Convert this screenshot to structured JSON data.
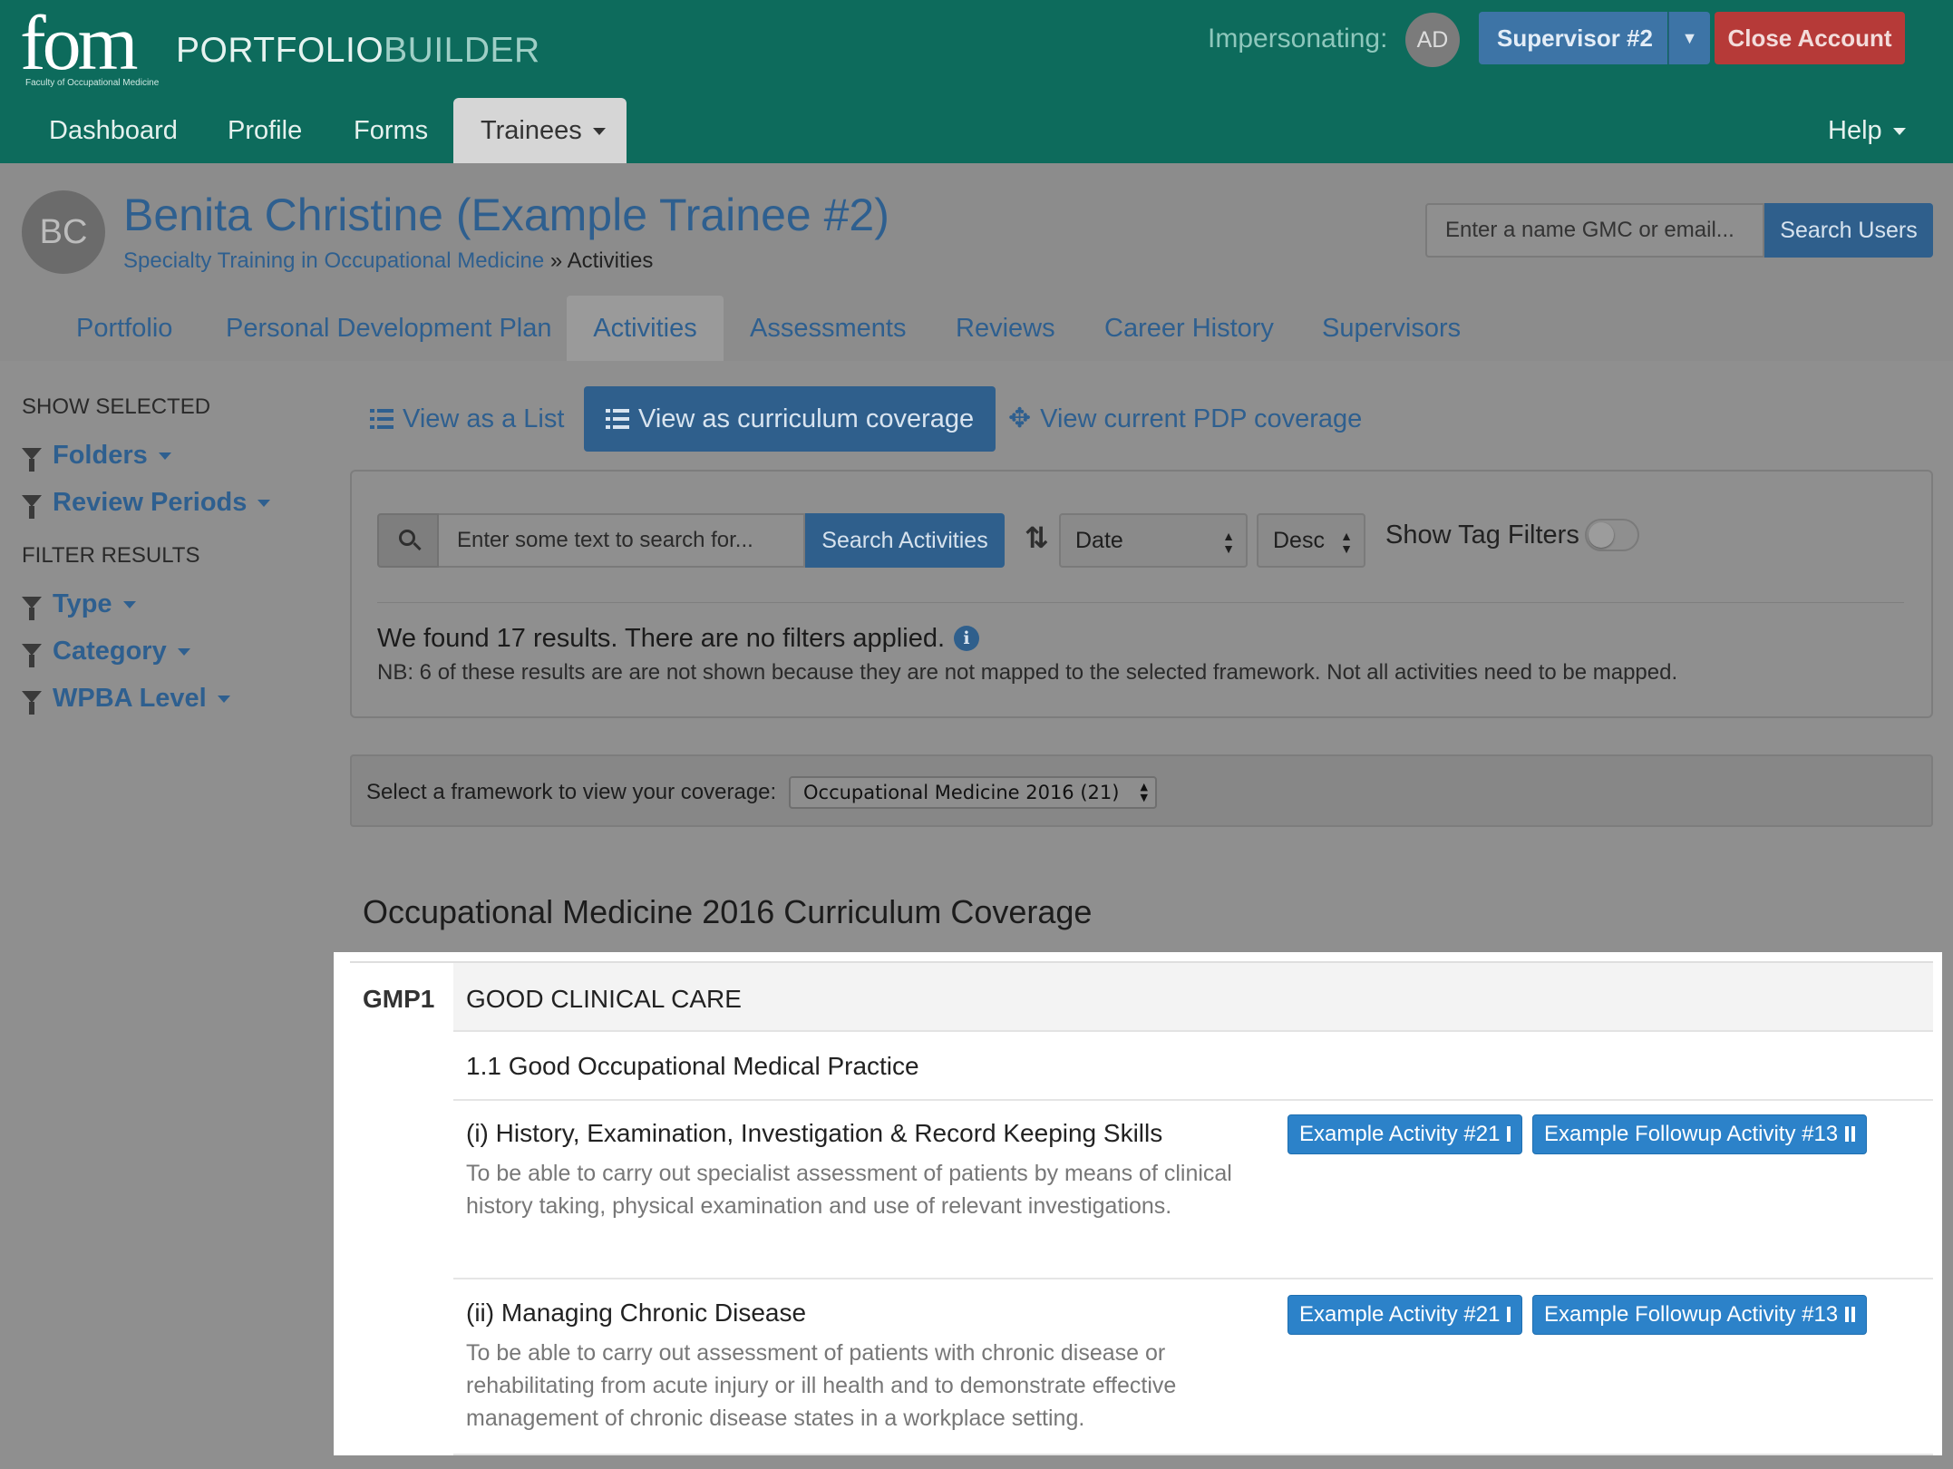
{
  "header": {
    "logo_text": "fom",
    "logo_subtitle": "Faculty of Occupational Medicine",
    "brand_part1": "PORTFOLIO",
    "brand_part2": "BUILDER",
    "impersonating_label": "Impersonating:",
    "impersonating_initials": "AD",
    "supervisor_label": "Supervisor #2",
    "close_account_label": "Close Account",
    "nav": [
      "Dashboard",
      "Profile",
      "Forms",
      "Trainees"
    ],
    "help_label": "Help"
  },
  "profile": {
    "initials": "BC",
    "name": "Benita Christine (Example Trainee #2)",
    "breadcrumb_link": "Specialty Training in Occupational Medicine",
    "breadcrumb_sep": "»",
    "breadcrumb_current": "Activities",
    "search_placeholder": "Enter a name GMC or email...",
    "search_button": "Search Users"
  },
  "tabs": [
    "Portfolio",
    "Personal Development Plan",
    "Activities",
    "Assessments",
    "Reviews",
    "Career History",
    "Supervisors"
  ],
  "active_tab": "Activities",
  "sidebar": {
    "show_selected_heading": "SHOW SELECTED",
    "show_selected": [
      "Folders",
      "Review Periods"
    ],
    "filter_results_heading": "FILTER RESULTS",
    "filter_results": [
      "Type",
      "Category",
      "WPBA Level"
    ]
  },
  "views": {
    "list": "View as a List",
    "curriculum": "View as curriculum coverage",
    "pdp": "View current PDP coverage"
  },
  "search": {
    "placeholder": "Enter some text to search for...",
    "button": "Search Activities",
    "sort_field": "Date",
    "sort_order": "Desc",
    "tag_filters_label": "Show Tag Filters",
    "tag_filters_on": false,
    "results_text": "We found 17 results. There are no filters applied.",
    "info_icon": "i",
    "nb_text": "NB: 6 of these results are are not shown because they are not mapped to the selected framework. Not all activities need to be mapped."
  },
  "framework": {
    "label": "Select a framework to view your coverage:",
    "selected": "Occupational Medicine 2016 (21)"
  },
  "coverage": {
    "title": "Occupational Medicine 2016 Curriculum Coverage",
    "gmp_code": "GMP1",
    "gmp_name": "GOOD CLINICAL CARE",
    "section": "1.1 Good Occupational Medical Practice",
    "items": [
      {
        "title": "(i) History, Examination, Investigation & Record Keeping Skills",
        "description": "To be able to carry out specialist assessment of patients by means of clinical history taking, physical examination and use of relevant investigations.",
        "activities": [
          "Example Activity #21",
          "Example Followup Activity #13"
        ]
      },
      {
        "title": "(ii) Managing Chronic Disease",
        "description": "To be able to carry out assessment of patients with chronic disease or rehabilitating from acute injury or ill health and to demonstrate effective management of chronic disease states in a workplace setting.",
        "activities": [
          "Example Activity #21",
          "Example Followup Activity #13"
        ]
      }
    ]
  },
  "colors": {
    "header_bg": "#0d6b5c",
    "primary_blue": "#2f5f8c",
    "activity_badge": "#2c82c9",
    "danger": "#b63a38"
  }
}
